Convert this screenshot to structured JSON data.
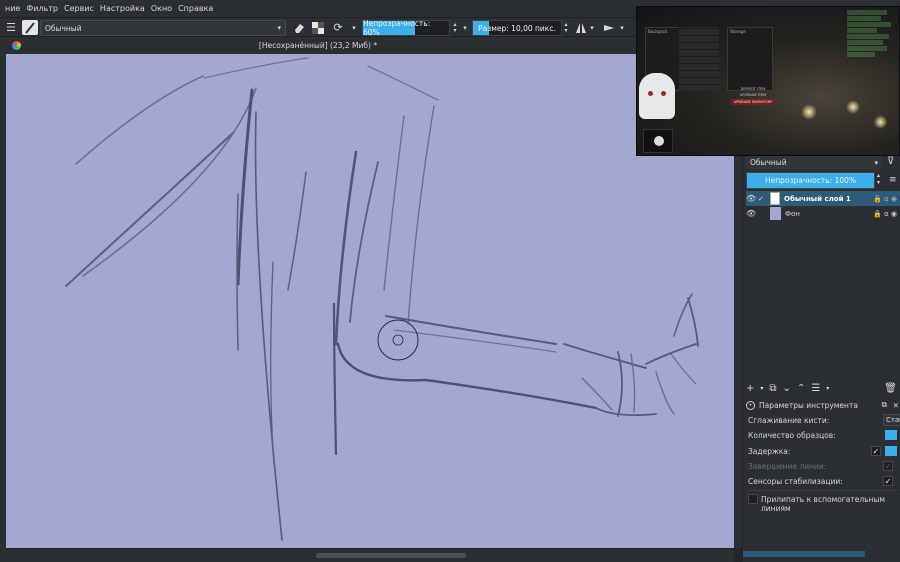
{
  "menu": [
    "ние",
    "Фильтр",
    "Сервис",
    "Настройка",
    "Окно",
    "Справка"
  ],
  "toolbar": {
    "brush_preset": "Обычный",
    "opacity_label": "Непрозрачность: 60%",
    "opacity_value": 0.6,
    "size_label": "Размер: 10,00 пикс.",
    "size_fill": 0.18
  },
  "document": {
    "title": "[Несохранённый]  (23,2 Миб) *"
  },
  "stream": {
    "inventory_tab1": "Backpack",
    "inventory_tab2": "Storage",
    "btn1": "DEPOSIT ITEM",
    "btn2": "UPGRADE ITEM",
    "btn3": "UPGRADE INVENTORY"
  },
  "layers": {
    "blend_mode": "Обычный",
    "opacity_label": "Непрозрачность:  100%",
    "items": [
      {
        "name": "Обычный слой 1"
      },
      {
        "name": "Фон"
      }
    ]
  },
  "tool_options": {
    "title": "Параметры инструмента",
    "smoothing_label": "Сглаживание кисти:",
    "smoothing_value": "Стаб",
    "samples_label": "Количество образцов:",
    "delay_label": "Задержка:",
    "finish_line_label": "Завершение линии:",
    "stabilize_sensors_label": "Сенсоры стабилизации:",
    "snap_label": "Прилипать к вспомогательным линиям"
  },
  "colors": {
    "canvas_bg": "#a4a8d0",
    "accent": "#3daee9",
    "panel_bg": "#2b2e32"
  }
}
